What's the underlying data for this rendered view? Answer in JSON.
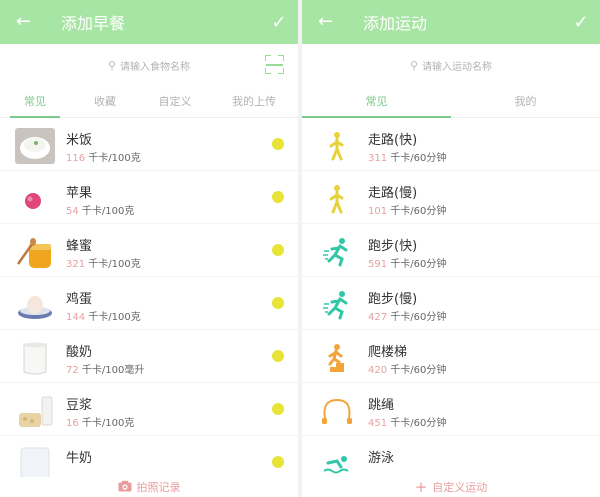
{
  "colors": {
    "header": "#a7e5a4",
    "accent": "#7cc98e",
    "kcal": "#e8a0a0",
    "dot": "#e8e337",
    "footer_text": "#e89d9d"
  },
  "food": {
    "header": {
      "title": "添加早餐",
      "back_icon": "arrow-left-icon",
      "confirm_icon": "check-icon"
    },
    "search": {
      "placeholder": "请输入食物名称",
      "icon": "search-icon"
    },
    "tabs": [
      {
        "label": "常见",
        "active": true
      },
      {
        "label": "收藏",
        "active": false
      },
      {
        "label": "自定义",
        "active": false
      },
      {
        "label": "我的上传",
        "active": false
      }
    ],
    "items": [
      {
        "name": "米饭",
        "kcal": "116",
        "unit": " 千卡/100克",
        "thumb": "rice"
      },
      {
        "name": "苹果",
        "kcal": "54",
        "unit": " 千卡/100克",
        "thumb": "apple"
      },
      {
        "name": "蜂蜜",
        "kcal": "321",
        "unit": " 千卡/100克",
        "thumb": "honey"
      },
      {
        "name": "鸡蛋",
        "kcal": "144",
        "unit": " 千卡/100克",
        "thumb": "egg"
      },
      {
        "name": "酸奶",
        "kcal": "72",
        "unit": " 千卡/100毫升",
        "thumb": "yogurt"
      },
      {
        "name": "豆浆",
        "kcal": "16",
        "unit": " 千卡/100克",
        "thumb": "soymilk"
      },
      {
        "name": "牛奶",
        "kcal": "",
        "unit": "",
        "thumb": "milk"
      }
    ],
    "footer": {
      "label": "拍照记录",
      "icon": "camera-icon"
    }
  },
  "exercise": {
    "header": {
      "title": "添加运动",
      "back_icon": "arrow-left-icon",
      "confirm_icon": "check-icon"
    },
    "search": {
      "placeholder": "请输入运动名称",
      "icon": "search-icon"
    },
    "tabs": [
      {
        "label": "常见",
        "active": true
      },
      {
        "label": "我的",
        "active": false
      }
    ],
    "items": [
      {
        "name": "走路(快)",
        "kcal": "311",
        "unit": " 千卡/60分钟",
        "icon": "walking-icon"
      },
      {
        "name": "走路(慢)",
        "kcal": "101",
        "unit": " 千卡/60分钟",
        "icon": "walking-icon"
      },
      {
        "name": "跑步(快)",
        "kcal": "591",
        "unit": " 千卡/60分钟",
        "icon": "running-icon"
      },
      {
        "name": "跑步(慢)",
        "kcal": "427",
        "unit": " 千卡/60分钟",
        "icon": "running-icon"
      },
      {
        "name": "爬楼梯",
        "kcal": "420",
        "unit": " 千卡/60分钟",
        "icon": "stairs-icon"
      },
      {
        "name": "跳绳",
        "kcal": "451",
        "unit": " 千卡/60分钟",
        "icon": "jump-rope-icon"
      },
      {
        "name": "游泳",
        "kcal": "",
        "unit": "",
        "icon": "swimming-icon"
      }
    ],
    "footer": {
      "label": "自定义运动",
      "icon": "plus-icon"
    }
  }
}
